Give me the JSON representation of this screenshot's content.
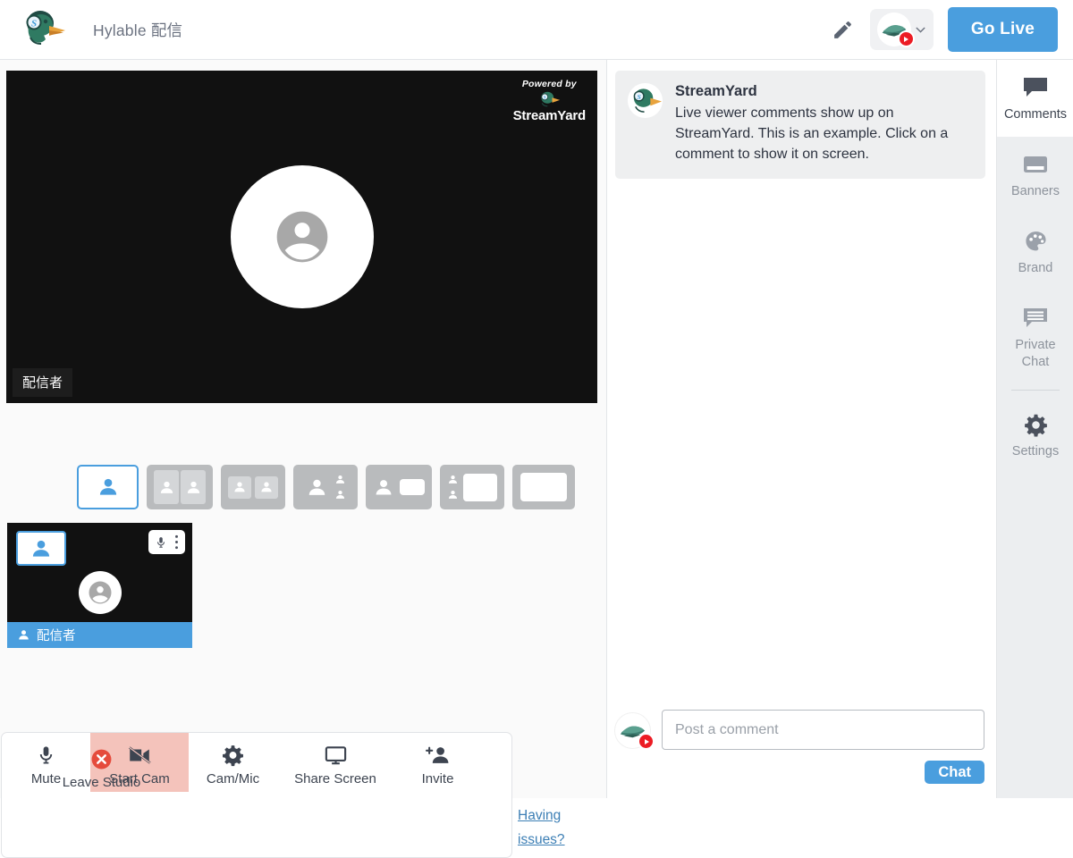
{
  "topbar": {
    "logo_icon": "streamyard-duck-logo",
    "title": "Hylable 配信",
    "edit_icon": "pencil-icon",
    "destination": {
      "avatar_icon": "destination-avatar",
      "platform_badge_icon": "youtube-icon",
      "chevron_icon": "chevron-down-icon"
    },
    "go_live_label": "Go Live"
  },
  "stage": {
    "watermark": {
      "prefix": "Powered by",
      "brand": "StreamYard",
      "logo_icon": "streamyard-duck-logo"
    },
    "avatar_icon": "person-placeholder-icon",
    "name_tag": "配信者"
  },
  "layouts": {
    "selected_index": 0,
    "options": [
      {
        "name": "layout-solo",
        "icon": "layout-solo-icon"
      },
      {
        "name": "layout-split-two",
        "icon": "layout-split-two-icon"
      },
      {
        "name": "layout-group-two",
        "icon": "layout-group-two-icon"
      },
      {
        "name": "layout-leader-two",
        "icon": "layout-leader-two-icon"
      },
      {
        "name": "layout-person-screen",
        "icon": "layout-person-screen-icon"
      },
      {
        "name": "layout-two-screen",
        "icon": "layout-two-screen-icon"
      },
      {
        "name": "layout-screen-only",
        "icon": "layout-screen-only-icon"
      }
    ]
  },
  "participant": {
    "add_to_stage_icon": "add-to-stage-icon",
    "mic_icon": "microphone-icon",
    "more_icon": "more-vertical-icon",
    "avatar_icon": "person-placeholder-icon",
    "name_icon": "person-icon",
    "name": "配信者"
  },
  "toolbar": {
    "buttons": [
      {
        "name": "mute-button",
        "label": "Mute",
        "icon": "microphone-icon",
        "active": false
      },
      {
        "name": "start-cam-button",
        "label": "Start Cam",
        "icon": "camera-off-icon",
        "active": true
      },
      {
        "name": "cam-mic-button",
        "label": "Cam/Mic",
        "icon": "gear-icon",
        "active": false
      },
      {
        "name": "share-screen-button",
        "label": "Share Screen",
        "icon": "monitor-icon",
        "active": false
      },
      {
        "name": "invite-button",
        "label": "Invite",
        "icon": "person-add-icon",
        "active": false
      },
      {
        "name": "leave-studio-button",
        "label": "Leave Studio",
        "icon": "close-circle-icon",
        "active": false
      }
    ],
    "having_issues_label": "Having issues?"
  },
  "comments": {
    "items": [
      {
        "author": "StreamYard",
        "avatar_icon": "streamyard-duck-logo",
        "text": "Live viewer comments show up on StreamYard. This is an example. Click on a comment to show it on screen."
      }
    ],
    "compose": {
      "avatar_icon": "destination-avatar",
      "platform_badge_icon": "youtube-icon",
      "placeholder": "Post a comment",
      "value": "",
      "send_label": "Chat"
    }
  },
  "sidebar": {
    "items": [
      {
        "name": "sidebar-item-comments",
        "label": "Comments",
        "icon": "comment-icon",
        "active": true
      },
      {
        "name": "sidebar-item-banners",
        "label": "Banners",
        "icon": "banner-icon",
        "active": false
      },
      {
        "name": "sidebar-item-brand",
        "label": "Brand",
        "icon": "palette-icon",
        "active": false
      },
      {
        "name": "sidebar-item-private-chat",
        "label": "Private Chat",
        "icon": "private-chat-icon",
        "active": false
      },
      {
        "name": "sidebar-item-settings",
        "label": "Settings",
        "icon": "gear-icon",
        "active": false
      }
    ]
  },
  "colors": {
    "accent": "#4a9ede",
    "active_tool": "#f4c3bb",
    "youtube_red": "#ec1c24",
    "stage_bg": "#111111"
  }
}
